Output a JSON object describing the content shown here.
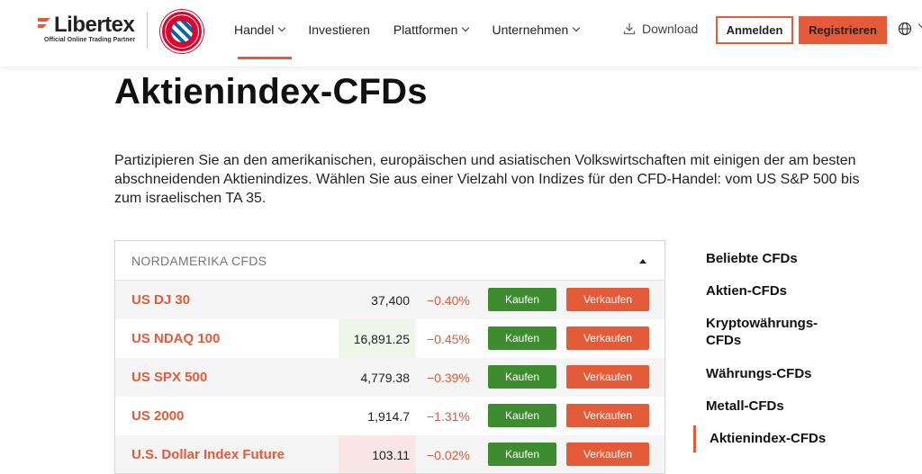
{
  "brand": {
    "name": "Libertex",
    "tagline": "Official Online Trading Partner",
    "accent": "#e35b39",
    "partner_logo": "fc-bayern-muenchen-crest"
  },
  "nav": {
    "items": [
      {
        "label": "Handel",
        "has_dropdown": true,
        "active": true
      },
      {
        "label": "Investieren",
        "has_dropdown": false,
        "active": false
      },
      {
        "label": "Plattformen",
        "has_dropdown": true,
        "active": false
      },
      {
        "label": "Unternehmen",
        "has_dropdown": true,
        "active": false
      }
    ],
    "download_label": "Download",
    "login_label": "Anmelden",
    "register_label": "Registrieren"
  },
  "page": {
    "title": "Aktienindex-CFDs",
    "intro": "Partizipieren Sie an den amerikanischen, europäischen und asiatischen Volkswirtschaften mit einigen der am besten abschneidenden Aktienindizes. Wählen Sie aus einer Vielzahl von Indizes für den CFD-Handel: vom US S&P 500 bis zum israelischen TA 35."
  },
  "table": {
    "section_label": "NORDAMERIKA CFDS",
    "buy_label": "Kaufen",
    "sell_label": "Verkaufen",
    "rows": [
      {
        "name": "US DJ 30",
        "price": "37,400",
        "change": "−0.40%",
        "flash": "none"
      },
      {
        "name": "US NDAQ 100",
        "price": "16,891.25",
        "change": "−0.45%",
        "flash": "up"
      },
      {
        "name": "US SPX 500",
        "price": "4,779.38",
        "change": "−0.39%",
        "flash": "none"
      },
      {
        "name": "US 2000",
        "price": "1,914.7",
        "change": "−1.31%",
        "flash": "none"
      },
      {
        "name": "U.S. Dollar Index Future",
        "price": "103.11",
        "change": "−0.02%",
        "flash": "down"
      }
    ]
  },
  "sidebar": {
    "items": [
      {
        "label": "Beliebte CFDs",
        "active": false
      },
      {
        "label": "Aktien-CFDs",
        "active": false
      },
      {
        "label": "Kryptowährungs-CFDs",
        "active": false
      },
      {
        "label": "Währungs-CFDs",
        "active": false
      },
      {
        "label": "Metall-CFDs",
        "active": false
      },
      {
        "label": "Aktienindex-CFDs",
        "active": true
      }
    ]
  }
}
